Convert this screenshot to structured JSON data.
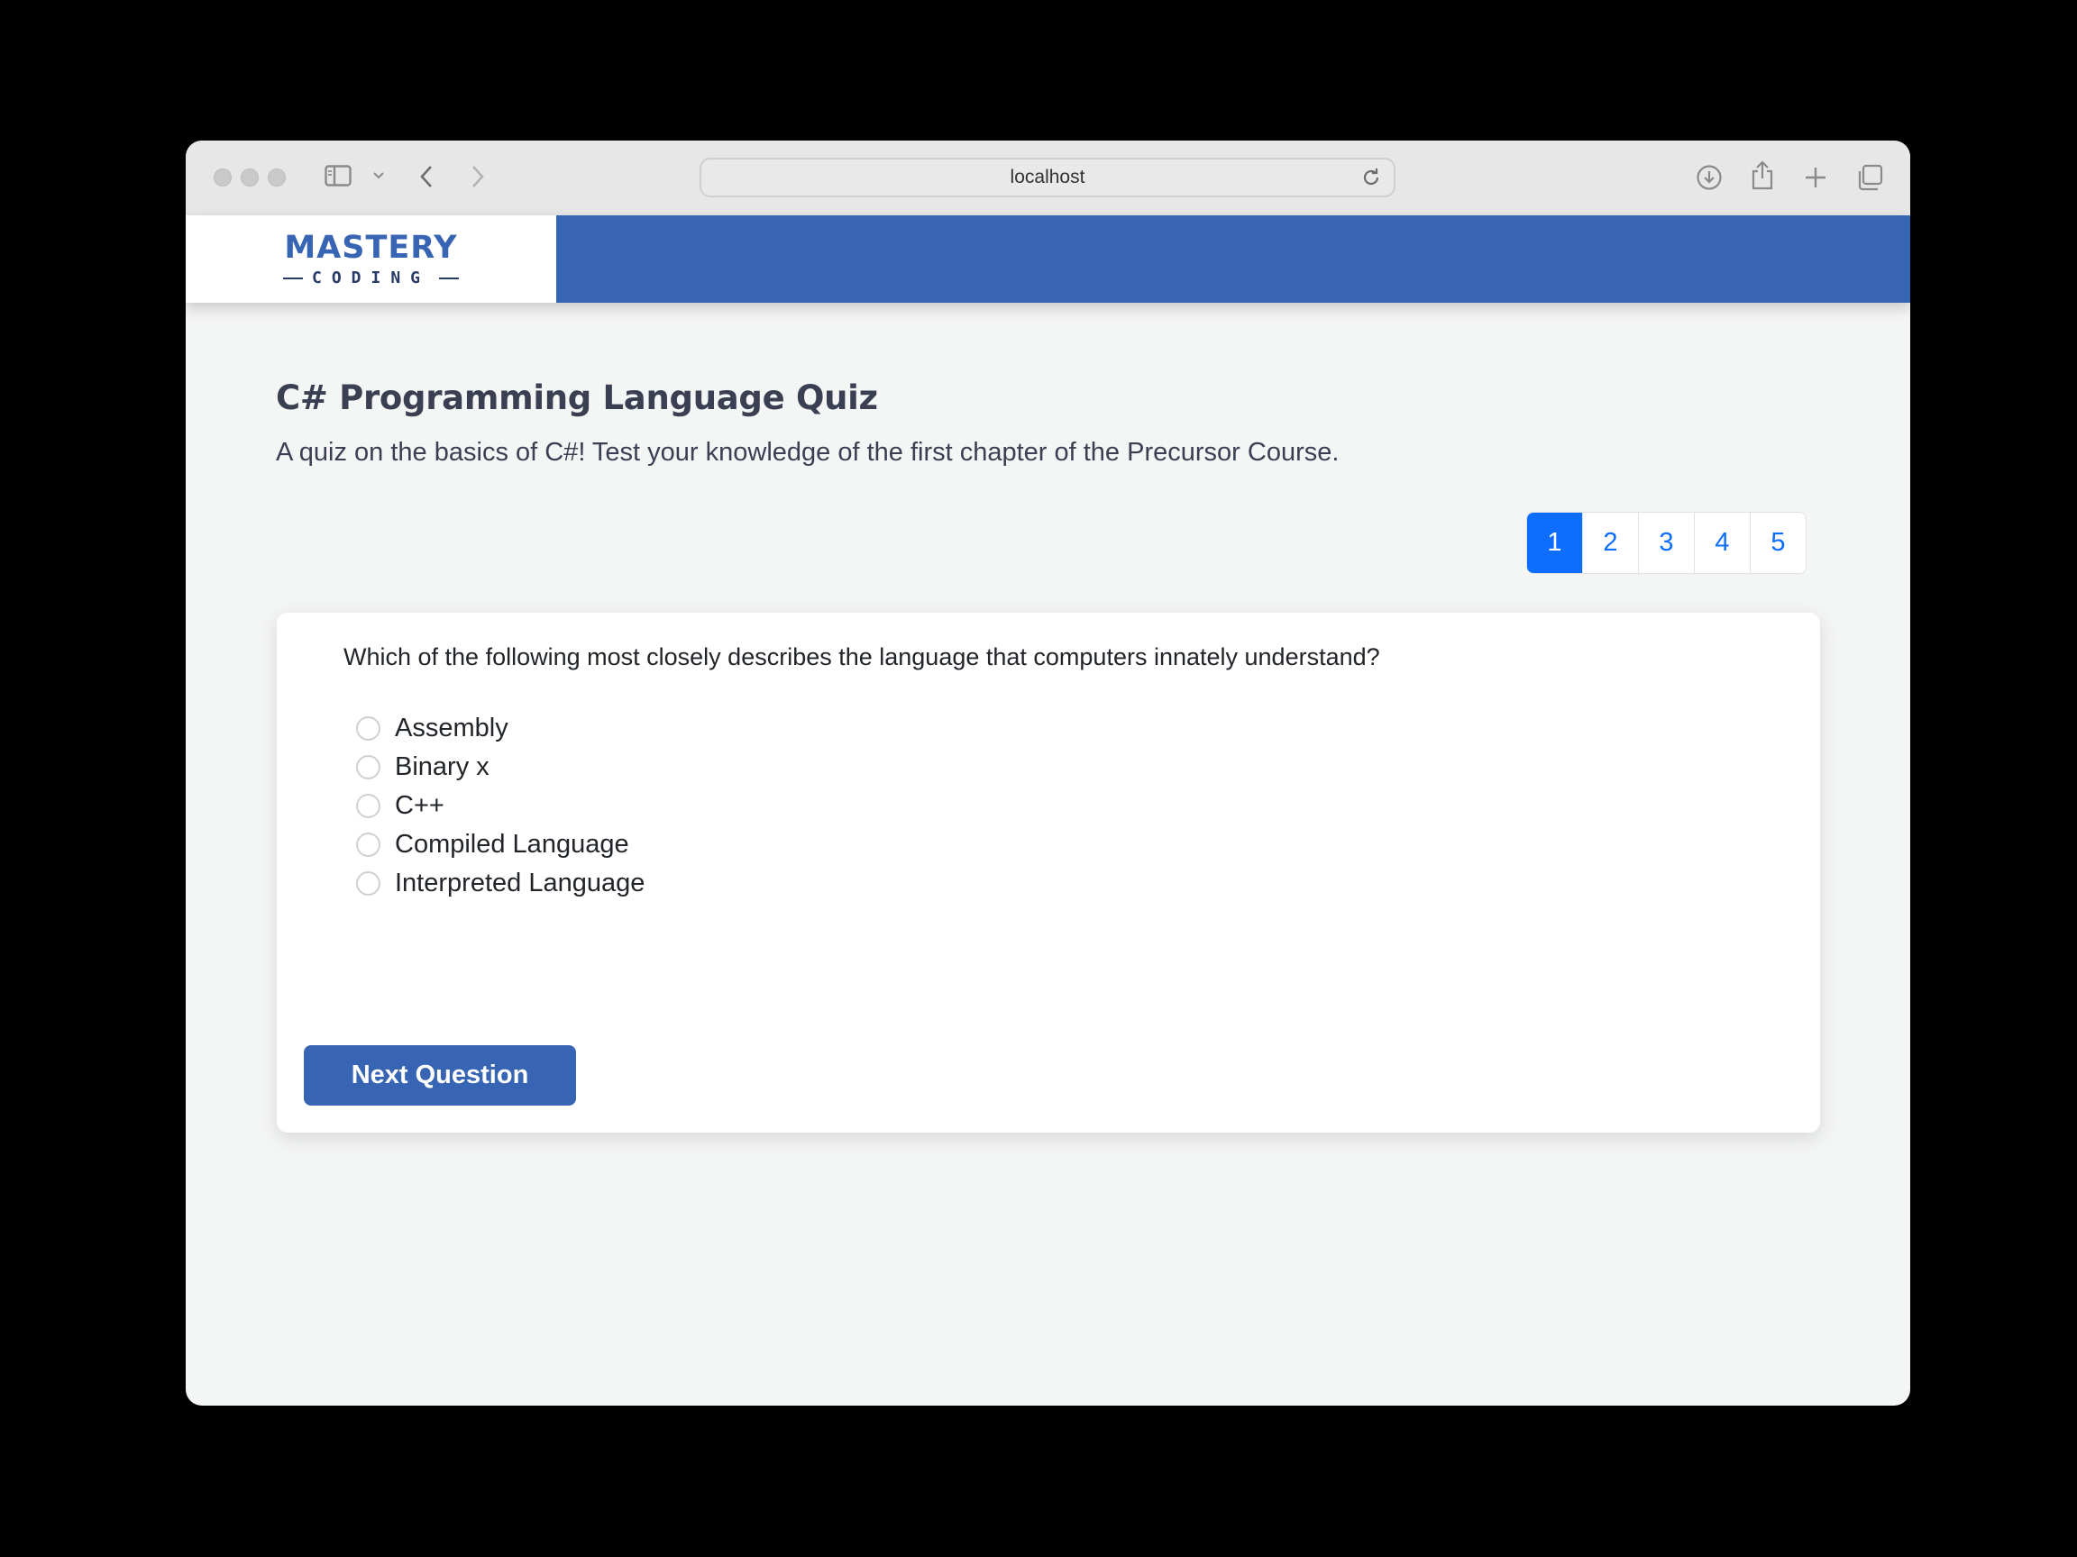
{
  "browser": {
    "url": "localhost",
    "icons": {
      "sidebar": "sidebar-icon",
      "back": "chevron-left-icon",
      "forward": "chevron-right-icon",
      "reload": "reload-icon",
      "download": "download-icon",
      "share": "share-icon",
      "new_tab": "plus-icon",
      "tabs": "tabs-overview-icon"
    }
  },
  "site": {
    "logo_main": "MASTERY",
    "logo_sub": "CODING",
    "brand_color": "#3765b3"
  },
  "quiz": {
    "title": "C# Programming Language Quiz",
    "description": "A quiz on the basics of C#! Test your knowledge of the first chapter of the Precursor Course.",
    "pages": [
      "1",
      "2",
      "3",
      "4",
      "5"
    ],
    "active_page": "1",
    "question": "Which of the following most closely describes the language that computers innately understand?",
    "options": [
      "Assembly",
      "Binary x",
      "C++",
      "Compiled Language",
      "Interpreted Language"
    ],
    "next_label": "Next Question"
  }
}
